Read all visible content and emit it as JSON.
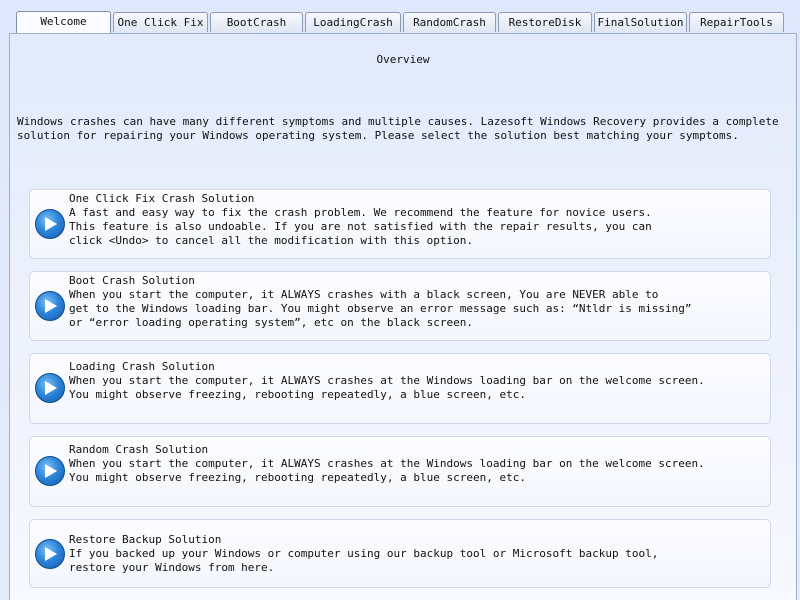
{
  "tabs": [
    {
      "label": "Welcome",
      "active": true
    },
    {
      "label": "One Click Fix",
      "active": false
    },
    {
      "label": "BootCrash",
      "active": false
    },
    {
      "label": "LoadingCrash",
      "active": false
    },
    {
      "label": "RandomCrash",
      "active": false
    },
    {
      "label": "RestoreDisk",
      "active": false
    },
    {
      "label": "FinalSolution",
      "active": false
    },
    {
      "label": "RepairTools",
      "active": false
    }
  ],
  "page": {
    "heading": "Overview",
    "intro": "Windows crashes can have many different symptoms and multiple causes. Lazesoft Windows Recovery provides a complete solution for repairing your Windows operating system. Please select the solution best matching your symptoms."
  },
  "solutions": [
    {
      "title": "One Click Fix Crash Solution",
      "desc": "A fast and easy way to fix the crash problem. We recommend the feature for novice users.\nThis feature is also undoable. If you are not satisfied with the repair results, you can\nclick <Undo> to cancel all the modification with this option.",
      "icon": "play-icon"
    },
    {
      "title": "Boot Crash Solution",
      "desc": "When you start the computer, it ALWAYS crashes with a black screen, You are NEVER able to\nget to the Windows loading bar. You might observe an error message such as: “Ntldr is missing”\nor “error loading operating system”, etc on the black screen.",
      "icon": "play-icon"
    },
    {
      "title": "Loading Crash Solution",
      "desc": "When you start the computer, it ALWAYS crashes at the Windows loading bar on the welcome screen.\nYou might observe freezing, rebooting repeatedly, a blue screen, etc.",
      "icon": "play-icon"
    },
    {
      "title": "Random Crash Solution",
      "desc": "When you start the computer, it ALWAYS crashes at the Windows loading bar on the welcome screen.\nYou might observe freezing, rebooting repeatedly, a blue screen, etc.",
      "icon": "play-icon"
    },
    {
      "title": "Restore Backup Solution",
      "desc": "If you backed up your Windows or computer using our backup tool or Microsoft backup tool,\nrestore your Windows from here.",
      "icon": "play-icon"
    }
  ]
}
